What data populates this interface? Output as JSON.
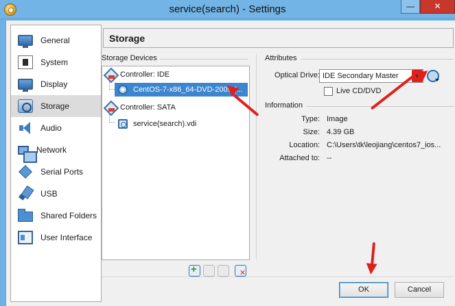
{
  "window": {
    "title": "service(search) - Settings",
    "minimize": "—",
    "close": "✕"
  },
  "sidebar": {
    "items": [
      {
        "label": "General",
        "icon": "monitor-icon"
      },
      {
        "label": "System",
        "icon": "chip-icon"
      },
      {
        "label": "Display",
        "icon": "display-icon"
      },
      {
        "label": "Storage",
        "icon": "storage-icon",
        "selected": true
      },
      {
        "label": "Audio",
        "icon": "speaker-icon"
      },
      {
        "label": "Network",
        "icon": "network-icon"
      },
      {
        "label": "Serial Ports",
        "icon": "serial-port-icon"
      },
      {
        "label": "USB",
        "icon": "usb-icon"
      },
      {
        "label": "Shared Folders",
        "icon": "folder-icon"
      },
      {
        "label": "User Interface",
        "icon": "user-interface-icon"
      }
    ]
  },
  "header": {
    "title": "Storage"
  },
  "storage_devices": {
    "group_title": "Storage Devices",
    "tree": [
      {
        "label": "Controller: IDE",
        "type": "controller"
      },
      {
        "label": "CentOS-7-x86_64-DVD-2009.(...",
        "type": "optical",
        "selected": true
      },
      {
        "label": "Controller: SATA",
        "type": "controller"
      },
      {
        "label": "service(search).vdi",
        "type": "hard-disk"
      }
    ]
  },
  "attributes": {
    "group_title": "Attributes",
    "optical_drive_label": "Optical Drive:",
    "optical_drive_value": "IDE Secondary Master",
    "live_cd_label": "Live CD/DVD",
    "live_cd_checked": false
  },
  "information": {
    "group_title": "Information",
    "rows": [
      {
        "label": "Type:",
        "value": "Image"
      },
      {
        "label": "Size:",
        "value": "4.39 GB"
      },
      {
        "label": "Location:",
        "value": "C:\\Users\\tk\\leojiang\\centos7_ios..."
      },
      {
        "label": "Attached to:",
        "value": "--"
      }
    ]
  },
  "buttons": {
    "ok": "OK",
    "cancel": "Cancel"
  },
  "colors": {
    "accent": "#3c85cf",
    "annotation": "#e0201c",
    "titlebar": "#73b4e6"
  }
}
